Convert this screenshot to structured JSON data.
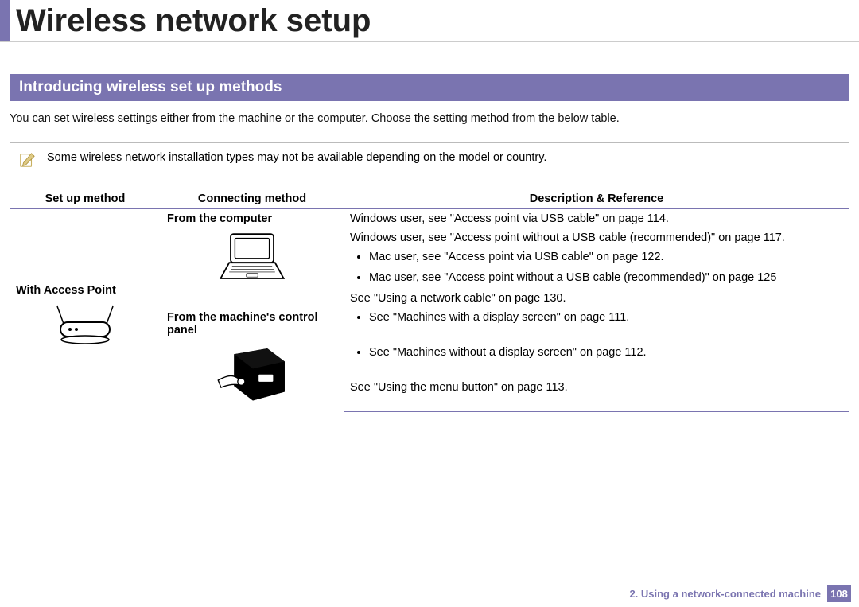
{
  "title": "Wireless network setup",
  "section_heading": "Introducing wireless set up methods",
  "intro_para": "You can set wireless settings either from the machine or the computer. Choose the setting method from the below table.",
  "note_text": "Some wireless network installation types may not be available depending on the model or country.",
  "table": {
    "headers": {
      "setup": "Set up method",
      "conn": "Connecting method",
      "desc": "Description & Reference"
    },
    "setup_label": "With Access Point",
    "conn_computer": "From the computer",
    "conn_panel": "From the machine's control panel",
    "desc_win_usb": "Windows user, see \"Access point via USB cable\" on page 114.",
    "desc_win_nousb": "Windows user, see \"Access point without a USB cable (recommended)\" on page 117.",
    "desc_mac_usb": "Mac user, see \"Access point via USB cable\" on page 122.",
    "desc_mac_nousb": "Mac user, see \"Access point without a USB cable (recommended)\" on page 125",
    "desc_net_cable": "See \"Using a network cable\" on page 130.",
    "desc_display": "See \"Machines with a display screen\" on page 111.",
    "desc_nodisplay": "See \"Machines without a display screen\" on page 112.",
    "desc_menu": "See \"Using the menu button\" on page 113."
  },
  "footer": {
    "chapter": "2.  Using a network-connected machine",
    "page": "108"
  }
}
